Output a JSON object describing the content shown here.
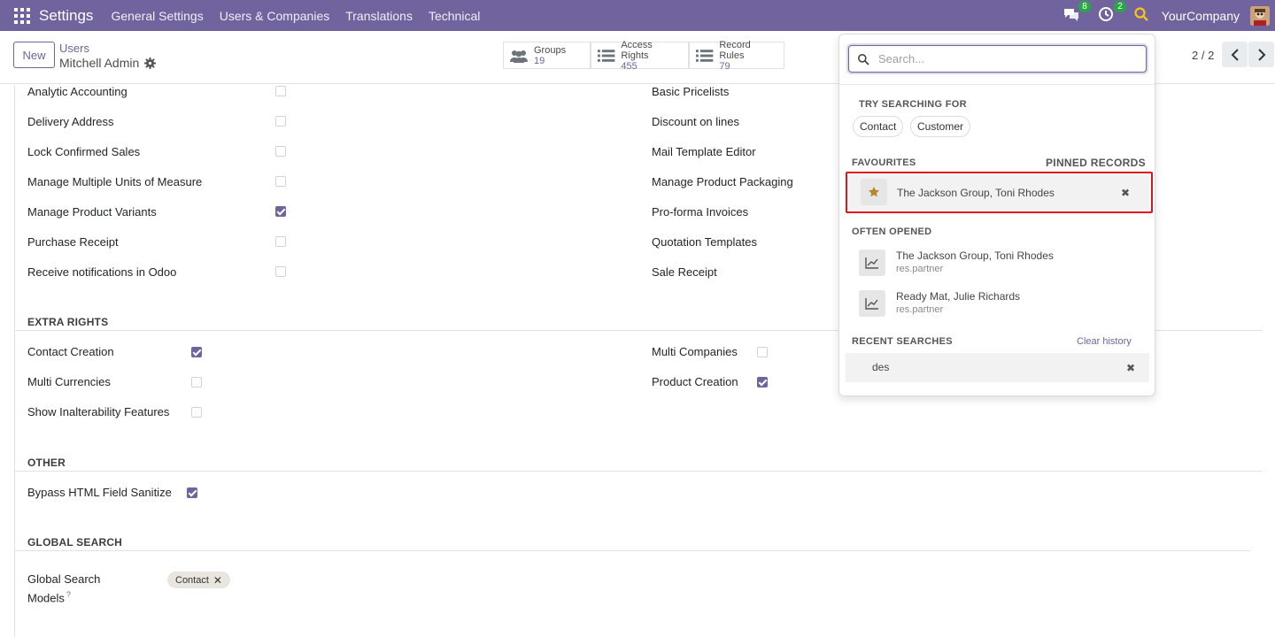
{
  "navbar": {
    "app_name": "Settings",
    "menus": [
      "General Settings",
      "Users & Companies",
      "Translations",
      "Technical"
    ],
    "messages_badge": "8",
    "activities_badge": "2",
    "company": "YourCompany"
  },
  "control": {
    "new_label": "New",
    "breadcrumb_parent": "Users",
    "breadcrumb_current": "Mitchell Admin",
    "stats": [
      {
        "label": "Groups",
        "value": "19"
      },
      {
        "label": "Access Rights",
        "value": "455"
      },
      {
        "label": "Record Rules",
        "value": "79"
      }
    ],
    "pager": "2 / 2"
  },
  "settings_left": [
    {
      "label": "Analytic Accounting",
      "checked": false
    },
    {
      "label": "Delivery Address",
      "checked": false
    },
    {
      "label": "Lock Confirmed Sales",
      "checked": false
    },
    {
      "label": "Manage Multiple Units of Measure",
      "checked": false
    },
    {
      "label": "Manage Product Variants",
      "checked": true
    },
    {
      "label": "Purchase Receipt",
      "checked": false
    },
    {
      "label": "Receive notifications in Odoo",
      "checked": false
    }
  ],
  "settings_right": [
    {
      "label": "Basic Pricelists"
    },
    {
      "label": "Discount on lines"
    },
    {
      "label": "Mail Template Editor"
    },
    {
      "label": "Manage Product Packaging"
    },
    {
      "label": "Pro-forma Invoices"
    },
    {
      "label": "Quotation Templates"
    },
    {
      "label": "Sale Receipt"
    }
  ],
  "extra_rights": {
    "title": "EXTRA RIGHTS",
    "left": [
      {
        "label": "Contact Creation",
        "checked": true
      },
      {
        "label": "Multi Currencies",
        "checked": false
      },
      {
        "label": "Show Inalterability Features",
        "checked": false
      }
    ],
    "right": [
      {
        "label": "Multi Companies",
        "checked": false
      },
      {
        "label": "Product Creation",
        "checked": true
      }
    ]
  },
  "other": {
    "title": "OTHER",
    "items": [
      {
        "label": "Bypass HTML Field Sanitize",
        "checked": true
      }
    ]
  },
  "global_search": {
    "title": "GLOBAL SEARCH",
    "field_label_1": "Global Search",
    "field_label_2": "Models",
    "help_mark": "?",
    "tag": "Contact"
  },
  "search_panel": {
    "placeholder": "Search...",
    "try_label": "TRY SEARCHING FOR",
    "try_chips": [
      "Contact",
      "Customer"
    ],
    "favourites_label": "FAVOURITES",
    "pinned_label": "PINNED RECORDS",
    "favourite_item": "The Jackson Group, Toni Rhodes",
    "often_label": "OFTEN OPENED",
    "often_items": [
      {
        "title": "The Jackson Group, Toni Rhodes",
        "model": "res.partner"
      },
      {
        "title": "Ready Mat, Julie Richards",
        "model": "res.partner"
      }
    ],
    "recent_label": "RECENT SEARCHES",
    "clear_label": "Clear history",
    "recent_item": "des"
  },
  "colors": {
    "brand": "#71639e",
    "highlight": "#e0141e"
  }
}
